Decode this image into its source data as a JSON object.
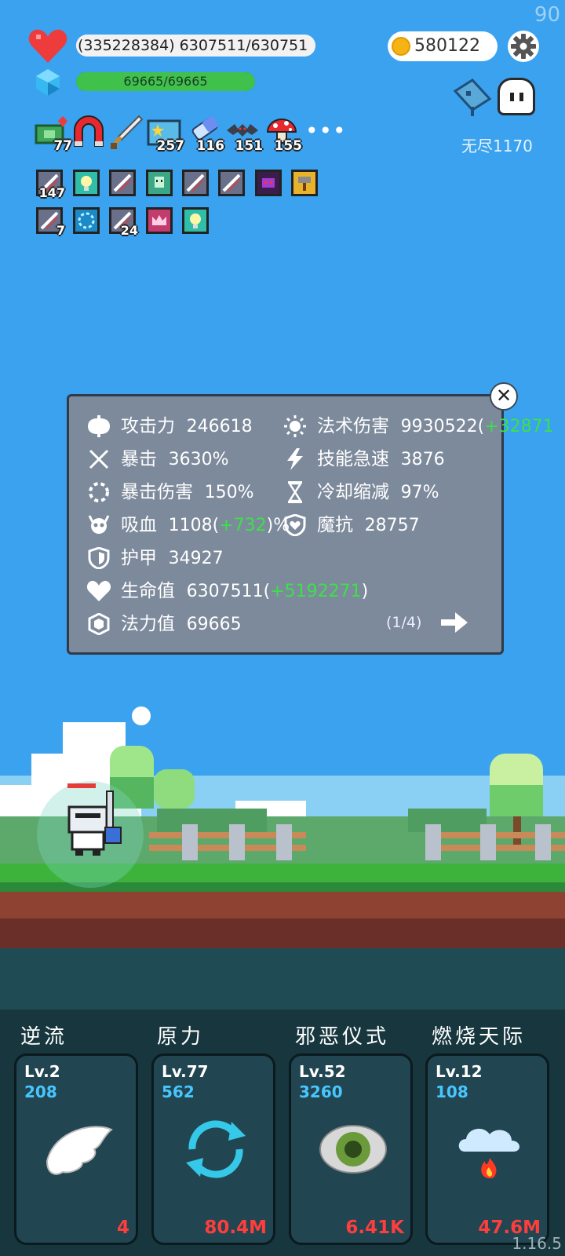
{
  "fps": "90",
  "hp": {
    "text": "(335228384) 6307511/630751",
    "fill_fraction": 1.0
  },
  "mp": {
    "text": "69665/69665",
    "fill_fraction": 1.0
  },
  "coins": "580122",
  "mode_label": "无尽1170",
  "items": [
    {
      "icon": "cash-heart-icon",
      "count": "77"
    },
    {
      "icon": "magnet-icon",
      "count": ""
    },
    {
      "icon": "sword-icon",
      "count": ""
    },
    {
      "icon": "star-card-icon",
      "count": "257"
    },
    {
      "icon": "eraser-icon",
      "count": "116"
    },
    {
      "icon": "bat-icon",
      "count": "151"
    },
    {
      "icon": "mushroom-icon",
      "count": "155"
    }
  ],
  "more_label": "•••",
  "buffs": [
    {
      "icon": "blade-buff-icon",
      "count": "147"
    },
    {
      "icon": "lightbulb-buff-icon",
      "count": ""
    },
    {
      "icon": "blade-buff-icon",
      "count": ""
    },
    {
      "icon": "ghost-buff-icon",
      "count": ""
    },
    {
      "icon": "blade-buff-icon",
      "count": ""
    },
    {
      "icon": "blade-buff-icon",
      "count": ""
    },
    {
      "icon": "demon-buff-icon",
      "count": ""
    },
    {
      "icon": "hammer-buff-icon",
      "count": ""
    },
    {
      "icon": "blade-buff-icon",
      "count": "7"
    },
    {
      "icon": "vortex-buff-icon",
      "count": ""
    },
    {
      "icon": "blade-buff-icon",
      "count": "24"
    },
    {
      "icon": "crown-buff-icon",
      "count": ""
    },
    {
      "icon": "lightbulb-buff-icon",
      "count": ""
    }
  ],
  "stats": {
    "attack": {
      "label": "攻击力",
      "value": "246618"
    },
    "crit": {
      "label": "暴击",
      "value": "3630%"
    },
    "crit_damage": {
      "label": "暴击伤害",
      "value": "150%"
    },
    "lifesteal": {
      "label": "吸血",
      "value": "1108",
      "bonus": "+732",
      "suffix": ")%"
    },
    "armor": {
      "label": "护甲",
      "value": "34927"
    },
    "health": {
      "label": "生命值",
      "value": "6307511",
      "bonus": "+5192271",
      "suffix": ")"
    },
    "mana": {
      "label": "法力值",
      "value": "69665"
    },
    "magic_damage": {
      "label": "法术伤害",
      "value": "9930522",
      "bonus": "+32871"
    },
    "skill_haste": {
      "label": "技能急速",
      "value": "3876"
    },
    "cooldown": {
      "label": "冷却缩减",
      "value": "97%"
    },
    "magic_resist": {
      "label": "魔抗",
      "value": "28757"
    },
    "page": "(1/4)"
  },
  "skills": [
    {
      "title": "逆流",
      "level": "Lv.2",
      "cost": "208",
      "amount": "4",
      "icon": "wing-icon"
    },
    {
      "title": "原力",
      "level": "Lv.77",
      "cost": "562",
      "amount": "80.4M",
      "icon": "cycle-arrows-icon"
    },
    {
      "title": "邪恶仪式",
      "level": "Lv.52",
      "cost": "3260",
      "amount": "6.41K",
      "icon": "eye-icon"
    },
    {
      "title": "燃烧天际",
      "level": "Lv.12",
      "cost": "108",
      "amount": "47.6M",
      "icon": "fire-cloud-icon"
    }
  ],
  "version": "1.16.5"
}
